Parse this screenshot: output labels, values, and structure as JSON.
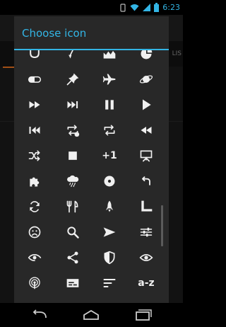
{
  "status_bar": {
    "time": "6:23"
  },
  "background_app": {
    "tab_label": "LIS"
  },
  "dialog": {
    "title": "Choose icon",
    "icons": [
      [
        "magnet-icon",
        "brush-icon",
        "landscape-icon",
        "pie-chart-icon"
      ],
      [
        "pill-icon",
        "pushpin-icon",
        "airplane-icon",
        "planet-icon"
      ],
      [
        "fast-forward-icon",
        "skip-next-icon",
        "pause-icon",
        "play-icon"
      ],
      [
        "skip-previous-icon",
        "repeat-one-icon",
        "repeat-icon",
        "rewind-icon"
      ],
      [
        "shuffle-icon",
        "stop-icon",
        "plus-one-icon",
        "presentation-icon"
      ],
      [
        "puzzle-icon",
        "rain-cloud-icon",
        "disc-icon",
        "redo-icon"
      ],
      [
        "sync-icon",
        "restaurant-icon",
        "rocket-icon",
        "ruler-corner-icon"
      ],
      [
        "sad-face-icon",
        "search-icon",
        "send-icon",
        "tune-icon"
      ],
      [
        "wave-eye-icon",
        "share-icon",
        "shield-icon",
        "eye-icon"
      ],
      [
        "podcast-icon",
        "subtitles-icon",
        "sort-icon",
        "sort-alpha-icon"
      ]
    ],
    "plus_one_text": "+1",
    "sort_alpha_text": "a-z"
  },
  "nav_bar": {
    "back": "back-icon",
    "home": "home-icon",
    "recents": "recents-icon"
  }
}
